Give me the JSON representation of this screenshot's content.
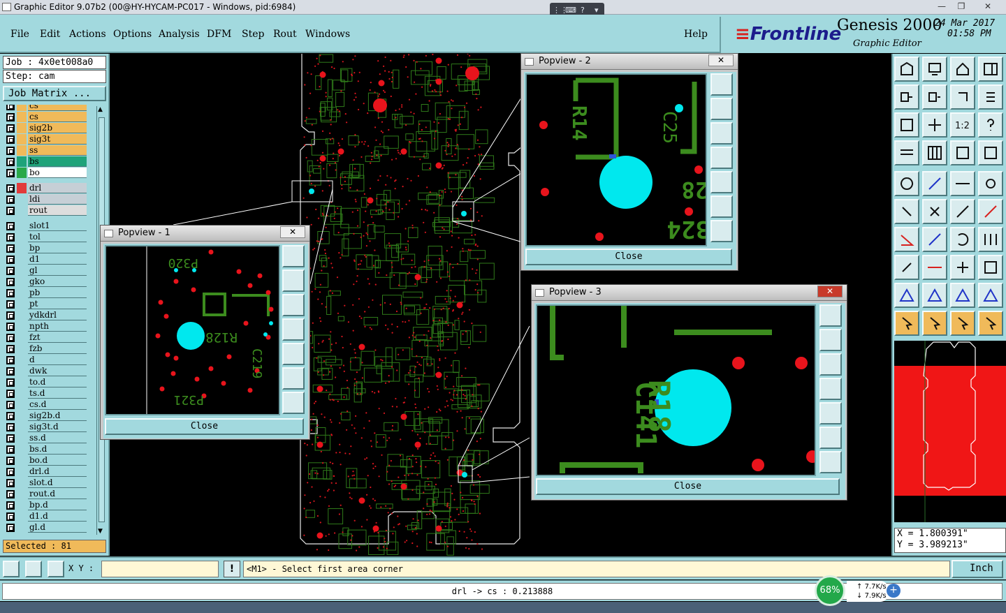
{
  "window": {
    "title": "Graphic Editor 9.07b2 (00@HY-HYCAM-PC017 - Windows, pid:6984)",
    "minimize": "—",
    "maximize": "❐",
    "close": "✕"
  },
  "menu": {
    "items": [
      "File",
      "Edit",
      "Actions",
      "Options",
      "Analysis",
      "DFM",
      "Step",
      "Rout",
      "Windows"
    ],
    "help": "Help"
  },
  "brand": {
    "logo": "Frontline",
    "product": "Genesis 2000",
    "subtitle": "Graphic Editor",
    "date": "24 Mar 2017",
    "time": "01:58 PM"
  },
  "left": {
    "job": "Job : 4x0et008a0",
    "step": "Step: cam",
    "job_matrix": "Job Matrix ...",
    "layers": [
      {
        "name": "cs",
        "color": "#f0ba5a",
        "bg": "#f0ba5a",
        "arrow": "⬋"
      },
      {
        "name": "cs",
        "color": "#f0ba5a",
        "bg": "#f0ba5a",
        "arrow": ""
      },
      {
        "name": "sig2b",
        "color": "#f0ba5a",
        "bg": "#f0ba5a",
        "arrow": "⬋"
      },
      {
        "name": "sig3t",
        "color": "#f0ba5a",
        "bg": "#f0ba5a",
        "arrow": ""
      },
      {
        "name": "ss",
        "color": "#f0ba5a",
        "bg": "#f0ba5a",
        "arrow": "⬋"
      },
      {
        "name": "bs",
        "color": "#1fa37a",
        "bg": "#1fa37a",
        "arrow": ""
      },
      {
        "name": "bo",
        "color": "#2aa84a",
        "bg": "#ffffff",
        "arrow": "⬋"
      },
      {
        "name": "drl",
        "color": "#e23b3b",
        "bg": "#c6cfd6",
        "arrow": "▣"
      },
      {
        "name": "ldi",
        "color": "#a2d9de",
        "bg": "#c6cfd6",
        "arrow": ""
      },
      {
        "name": "rout",
        "color": "#a2d9de",
        "bg": "#dddddd",
        "arrow": ""
      },
      {
        "name": "slot1",
        "color": "#a2d9de",
        "bg": "#a2d9de",
        "arrow": ""
      },
      {
        "name": "tol",
        "color": "#a2d9de",
        "bg": "#a2d9de",
        "arrow": "⬋"
      },
      {
        "name": "bp",
        "color": "#a2d9de",
        "bg": "#a2d9de",
        "arrow": ""
      },
      {
        "name": "d1",
        "color": "#a2d9de",
        "bg": "#a2d9de",
        "arrow": "⬋"
      },
      {
        "name": "gl",
        "color": "#a2d9de",
        "bg": "#a2d9de",
        "arrow": ""
      },
      {
        "name": "gko",
        "color": "#a2d9de",
        "bg": "#a2d9de",
        "arrow": "⬋"
      },
      {
        "name": "pb",
        "color": "#a2d9de",
        "bg": "#a2d9de",
        "arrow": ""
      },
      {
        "name": "pt",
        "color": "#a2d9de",
        "bg": "#a2d9de",
        "arrow": ""
      },
      {
        "name": "ydkdrl",
        "color": "#a2d9de",
        "bg": "#a2d9de",
        "arrow": ""
      },
      {
        "name": "npth",
        "color": "#a2d9de",
        "bg": "#a2d9de",
        "arrow": ""
      },
      {
        "name": "fzt",
        "color": "#a2d9de",
        "bg": "#a2d9de",
        "arrow": ""
      },
      {
        "name": "fzb",
        "color": "#a2d9de",
        "bg": "#a2d9de",
        "arrow": ""
      },
      {
        "name": "d",
        "color": "#a2d9de",
        "bg": "#a2d9de",
        "arrow": ""
      },
      {
        "name": "dwk",
        "color": "#a2d9de",
        "bg": "#a2d9de",
        "arrow": ""
      },
      {
        "name": "to.d",
        "color": "#a2d9de",
        "bg": "#a2d9de",
        "arrow": "⬋"
      },
      {
        "name": "ts.d",
        "color": "#a2d9de",
        "bg": "#a2d9de",
        "arrow": "⬋"
      },
      {
        "name": "cs.d",
        "color": "#a2d9de",
        "bg": "#a2d9de",
        "arrow": ""
      },
      {
        "name": "sig2b.d",
        "color": "#a2d9de",
        "bg": "#a2d9de",
        "arrow": "⬋"
      },
      {
        "name": "sig3t.d",
        "color": "#a2d9de",
        "bg": "#a2d9de",
        "arrow": ""
      },
      {
        "name": "ss.d",
        "color": "#a2d9de",
        "bg": "#a2d9de",
        "arrow": "⬋"
      },
      {
        "name": "bs.d",
        "color": "#a2d9de",
        "bg": "#a2d9de",
        "arrow": ""
      },
      {
        "name": "bo.d",
        "color": "#a2d9de",
        "bg": "#a2d9de",
        "arrow": "⬋"
      },
      {
        "name": "drl.d",
        "color": "#a2d9de",
        "bg": "#a2d9de",
        "arrow": ""
      },
      {
        "name": "slot.d",
        "color": "#a2d9de",
        "bg": "#a2d9de",
        "arrow": ""
      },
      {
        "name": "rout.d",
        "color": "#a2d9de",
        "bg": "#a2d9de",
        "arrow": ""
      },
      {
        "name": "bp.d",
        "color": "#a2d9de",
        "bg": "#a2d9de",
        "arrow": ""
      },
      {
        "name": "d1.d",
        "color": "#a2d9de",
        "bg": "#a2d9de",
        "arrow": "⬋"
      },
      {
        "name": "gl.d",
        "color": "#a2d9de",
        "bg": "#a2d9de",
        "arrow": ""
      }
    ],
    "selected": "Selected : 81"
  },
  "popviews": [
    {
      "title": "Popview - 1",
      "close_label": "Close",
      "labels": [
        "P320",
        "R128",
        "C219",
        "P321"
      ]
    },
    {
      "title": "Popview - 2",
      "close_label": "Close",
      "labels": [
        "R14",
        "C25",
        "28",
        "324"
      ]
    },
    {
      "title": "Popview - 3",
      "close_label": "Close",
      "labels": [
        "C141",
        "R18"
      ]
    }
  ],
  "right": {
    "toolbar_icons": [
      "zoom-home-icon",
      "zoom-back-icon",
      "home-icon",
      "window-icon",
      "pan-left-icon",
      "pan-right-icon",
      "swap-icon",
      "snap-icon",
      "fit-icon",
      "center-icon",
      "ratio-icon",
      "help-icon",
      "measure-icon",
      "grid-icon",
      "layers-color-icon",
      "layers-edit-icon",
      "pad-icon",
      "line-icon",
      "ruler-icon",
      "point-icon",
      "nodes-icon",
      "cross-icon",
      "line-add-icon",
      "line-red-icon",
      "angle-icon",
      "diag-icon",
      "arc-icon",
      "ff-icon",
      "link-icon",
      "hline-icon",
      "arrows-icon",
      "group-icon",
      "tri-icon",
      "tri-a-icon",
      "tri-b-icon",
      "tri-c-icon",
      "pointer-icon",
      "pointer-box-icon",
      "pointer-circle-icon",
      "pointer-tool-icon"
    ],
    "ratio_label": "1:2",
    "coord_x": "X = 1.800391\"",
    "coord_y": "Y = 3.989213\""
  },
  "bottom": {
    "xy_label": "X Y :",
    "xy_value": "",
    "warn": "!",
    "message": "<M1> - Select first area corner",
    "unit": "Inch",
    "status": "drl -> cs : 0.213888"
  },
  "net": {
    "percent": "68%",
    "up": "7.7K/s",
    "down": "7.9K/s"
  }
}
